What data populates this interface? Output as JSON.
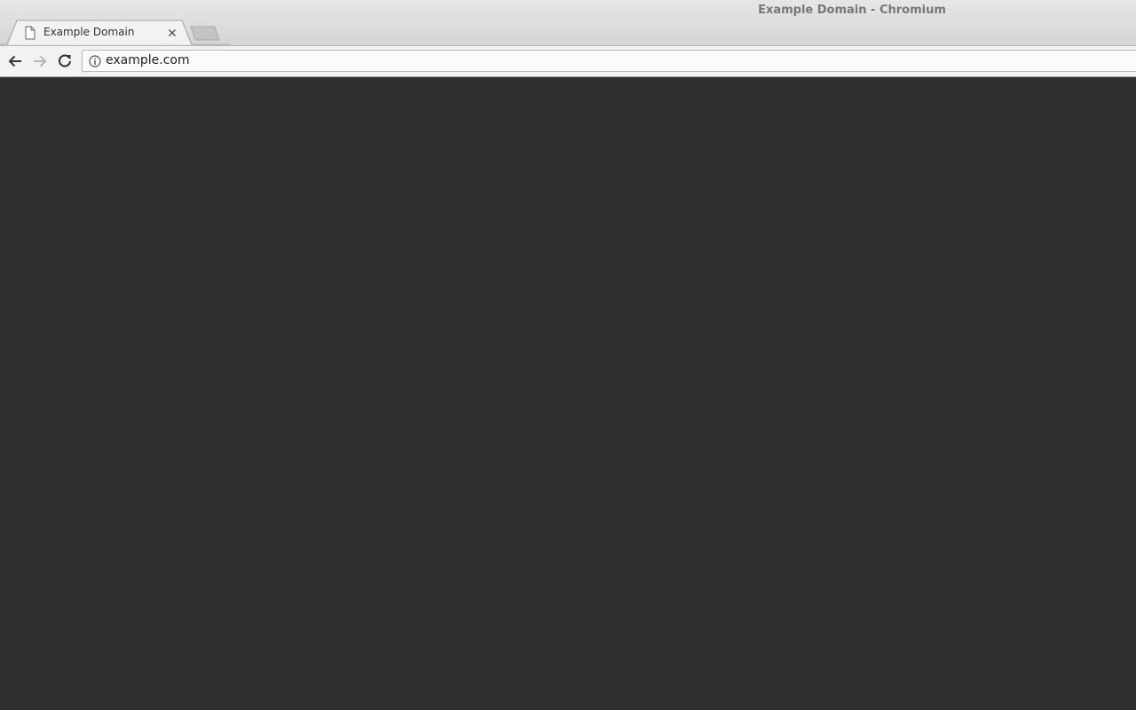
{
  "window": {
    "title": "Example Domain - Chromium"
  },
  "tabs": [
    {
      "title": "Example Domain",
      "icon": "page-icon",
      "active": true
    }
  ],
  "toolbar": {
    "back_icon": "arrow-left-icon",
    "forward_icon": "arrow-right-icon",
    "reload_icon": "reload-icon"
  },
  "omnibox": {
    "security_icon": "info-icon",
    "url": "example.com"
  },
  "colors": {
    "content_background": "#2f2f2f",
    "chrome_background": "#d9d9d9"
  }
}
